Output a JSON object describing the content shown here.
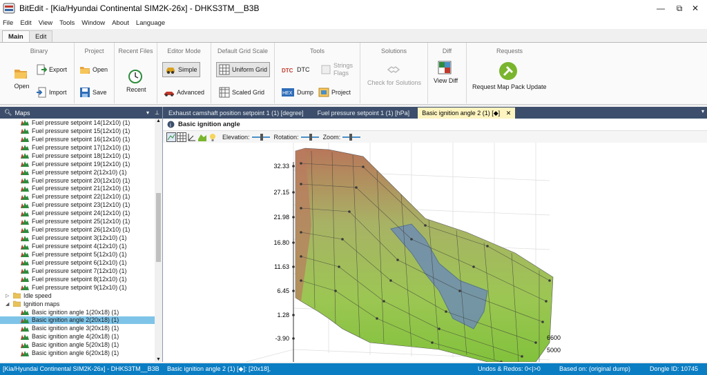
{
  "window": {
    "title": "BitEdit - [Kia/Hyundai Continental SIM2K-26x] - DHKS3TM__B3B",
    "controls": [
      "—",
      "⧉",
      "✕"
    ]
  },
  "menu": [
    "File",
    "Edit",
    "View",
    "Tools",
    "Window",
    "About",
    "Language"
  ],
  "ribbon_tabs": [
    "Main",
    "Edit"
  ],
  "ribbon": {
    "binary": {
      "title": "Binary",
      "open": "Open",
      "export": "Export",
      "import": "Import"
    },
    "project": {
      "title": "Project",
      "open": "Open",
      "save": "Save"
    },
    "recent": {
      "title": "Recent Files",
      "recent": "Recent"
    },
    "editor_mode": {
      "title": "Editor Mode",
      "simple": "Simple",
      "advanced": "Advanced"
    },
    "grid_scale": {
      "title": "Default Grid Scale",
      "uniform": "Uniform Grid",
      "scaled": "Scaled Grid"
    },
    "tools": {
      "title": "Tools",
      "dtc": "DTC",
      "strings": "Strings",
      "flags": "Flags",
      "dump": "Dump",
      "project": "Project"
    },
    "solutions": {
      "title": "Solutions",
      "check": "Check for Solutions"
    },
    "diff": {
      "title": "Diff",
      "view": "View Diff"
    },
    "requests": {
      "title": "Requests",
      "update": "Request Map Pack Update"
    }
  },
  "maps_panel": {
    "title": "Maps",
    "items": [
      {
        "label": "Fuel pressure setpoint 14(12x10) (1)",
        "kind": "map"
      },
      {
        "label": "Fuel pressure setpoint 15(12x10) (1)",
        "kind": "map"
      },
      {
        "label": "Fuel pressure setpoint 16(12x10) (1)",
        "kind": "map"
      },
      {
        "label": "Fuel pressure setpoint 17(12x10) (1)",
        "kind": "map"
      },
      {
        "label": "Fuel pressure setpoint 18(12x10) (1)",
        "kind": "map"
      },
      {
        "label": "Fuel pressure setpoint 19(12x10) (1)",
        "kind": "map"
      },
      {
        "label": "Fuel pressure setpoint 2(12x10) (1)",
        "kind": "map"
      },
      {
        "label": "Fuel pressure setpoint 20(12x10) (1)",
        "kind": "map"
      },
      {
        "label": "Fuel pressure setpoint 21(12x10) (1)",
        "kind": "map"
      },
      {
        "label": "Fuel pressure setpoint 22(12x10) (1)",
        "kind": "map"
      },
      {
        "label": "Fuel pressure setpoint 23(12x10) (1)",
        "kind": "map"
      },
      {
        "label": "Fuel pressure setpoint 24(12x10) (1)",
        "kind": "map"
      },
      {
        "label": "Fuel pressure setpoint 25(12x10) (1)",
        "kind": "map"
      },
      {
        "label": "Fuel pressure setpoint 26(12x10) (1)",
        "kind": "map"
      },
      {
        "label": "Fuel pressure setpoint 3(12x10) (1)",
        "kind": "map"
      },
      {
        "label": "Fuel pressure setpoint 4(12x10) (1)",
        "kind": "map"
      },
      {
        "label": "Fuel pressure setpoint 5(12x10) (1)",
        "kind": "map"
      },
      {
        "label": "Fuel pressure setpoint 6(12x10) (1)",
        "kind": "map"
      },
      {
        "label": "Fuel pressure setpoint 7(12x10) (1)",
        "kind": "map"
      },
      {
        "label": "Fuel pressure setpoint 8(12x10) (1)",
        "kind": "map"
      },
      {
        "label": "Fuel pressure setpoint 9(12x10) (1)",
        "kind": "map"
      },
      {
        "label": "Idle speed",
        "kind": "folder-collapsed"
      },
      {
        "label": "Ignition maps",
        "kind": "folder-expanded"
      },
      {
        "label": "Basic ignition angle 1(20x18) (1)",
        "kind": "map"
      },
      {
        "label": "Basic ignition angle 2(20x18) (1)",
        "kind": "map",
        "selected": true
      },
      {
        "label": "Basic ignition angle 3(20x18) (1)",
        "kind": "map"
      },
      {
        "label": "Basic ignition angle 4(20x18) (1)",
        "kind": "map"
      },
      {
        "label": "Basic ignition angle 5(20x18) (1)",
        "kind": "map"
      },
      {
        "label": "Basic ignition angle 6(20x18) (1)",
        "kind": "map"
      }
    ]
  },
  "doc_tabs": [
    {
      "label": "Exhaust camshaft position setpoint 1 (1) [degree]",
      "active": false
    },
    {
      "label": "Fuel pressure setpoint 1 (1) [hPa]",
      "active": false
    },
    {
      "label": "Basic ignition angle 2 (1) [◆]",
      "active": true
    }
  ],
  "map_view": {
    "title": "Basic ignition angle",
    "elevation_label": "Elevation:",
    "rotation_label": "Rotation:",
    "zoom_label": "Zoom:",
    "y_ticks": [
      "32.33",
      "27.15",
      "21.98",
      "16.80",
      "11.63",
      "6.45",
      "1.28",
      "-3.90"
    ],
    "depth_ticks": [
      "6600",
      "5000"
    ]
  },
  "status": {
    "file": "[Kia/Hyundai Continental SIM2K-26x] - DHKS3TM__B3B",
    "map": "Basic ignition angle 2 (1) [◆]: [20x18],",
    "undos": "Undos & Redos: 0<|>0",
    "based": "Based on: (original dump)",
    "dongle": "Dongle ID: 10745"
  },
  "colors": {
    "accent": "#0b7dc3",
    "panel_header": "#3c4e6b",
    "selection": "#7ec4e8",
    "active_tab": "#fdf4bf"
  }
}
